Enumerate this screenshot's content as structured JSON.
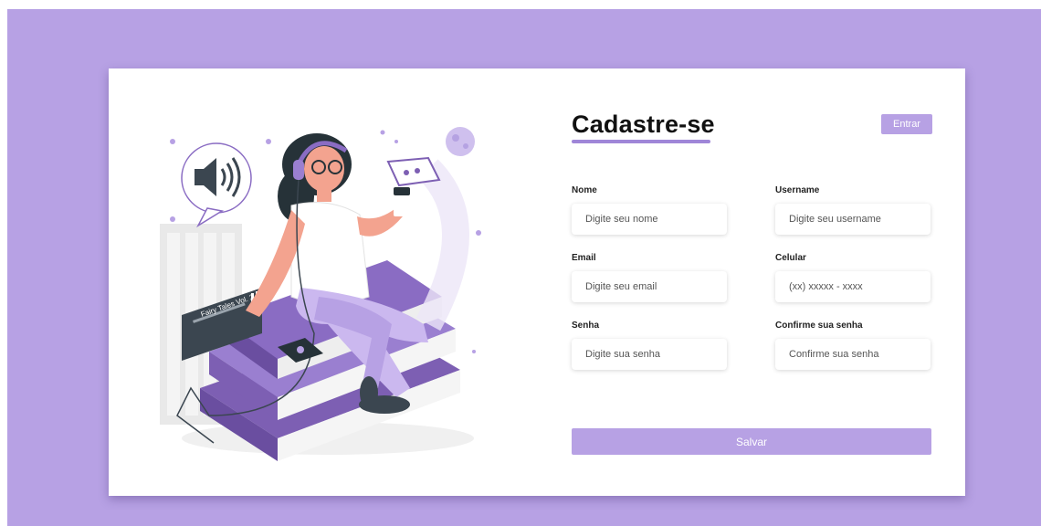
{
  "page": {
    "background_color": "#b7a1e4",
    "accent_color": "#9f86d8"
  },
  "illustration": {
    "player_label": "Fairy Tales Vol. 2",
    "icons": [
      "speaker-icon",
      "rocket-icon",
      "planet-icon",
      "headphones-icon",
      "coffee-cup-icon",
      "phone-icon",
      "star-icon"
    ]
  },
  "form": {
    "title": "Cadastre-se",
    "login_button": "Entrar",
    "fields": {
      "name": {
        "label": "Nome",
        "placeholder": "Digite seu nome"
      },
      "username": {
        "label": "Username",
        "placeholder": "Digite seu username"
      },
      "email": {
        "label": "Email",
        "placeholder": "Digite seu email"
      },
      "phone": {
        "label": "Celular",
        "placeholder": "(xx) xxxxx - xxxx"
      },
      "password": {
        "label": "Senha",
        "placeholder": "Digite sua senha"
      },
      "confirm_password": {
        "label": "Confirme sua senha",
        "placeholder": "Confirme sua senha"
      }
    },
    "save_button": "Salvar"
  }
}
